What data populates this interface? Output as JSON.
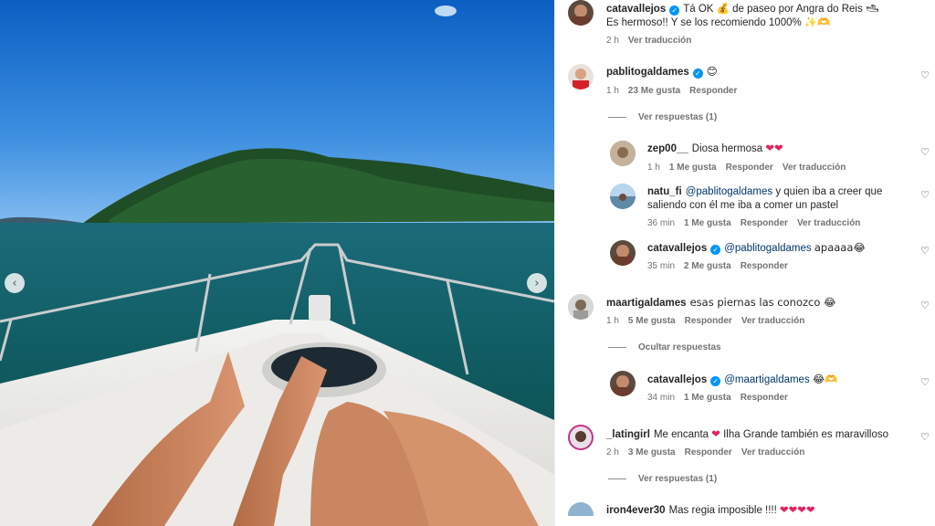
{
  "photo": {
    "prev_icon": "chevron-left-icon",
    "next_icon": "chevron-right-icon",
    "prev_glyph": "‹",
    "next_glyph": "›"
  },
  "caption": {
    "username": "catavallejos",
    "text1": "Tá OK 💰 de paseo por Angra do Reis 🛥",
    "text2": "Es hermoso!! Y se los recomiendo 1000% ✨🫶",
    "time": "2 h",
    "translate": "Ver traducción"
  },
  "comments": [
    {
      "username": "pablitogaldames",
      "verified": true,
      "text": "😊",
      "time": "1 h",
      "likes": "23 Me gusta",
      "reply": "Responder"
    },
    {
      "username": "zep00__",
      "text": "Diosa hermosa",
      "text_suffix": "❤❤",
      "time": "1 h",
      "likes": "1 Me gusta",
      "reply": "Responder",
      "translate": "Ver traducción"
    },
    {
      "username": "natu_fi",
      "mention": "@pablitogaldames",
      "text": "y quien iba a creer que",
      "text2": "saliendo con él me iba a comer un pastel",
      "time": "36 min",
      "likes": "1 Me gusta",
      "reply": "Responder",
      "translate": "Ver traducción"
    },
    {
      "username": "catavallejos",
      "verified": true,
      "mention": "@pablitogaldames",
      "text": "apaaaa😂",
      "time": "35 min",
      "likes": "2 Me gusta",
      "reply": "Responder"
    },
    {
      "username": "maartigaldames",
      "text": "esas piernas las conozco 😂",
      "time": "1 h",
      "likes": "5 Me gusta",
      "reply": "Responder",
      "translate": "Ver traducción"
    },
    {
      "username": "catavallejos",
      "verified": true,
      "mention": "@maartigaldames",
      "text": "😂🫶",
      "time": "34 min",
      "likes": "1 Me gusta",
      "reply": "Responder"
    },
    {
      "username": "_latingirl",
      "text": "Me encanta",
      "text_heart": "❤",
      "text_after": "Ilha Grande también es maravilloso",
      "time": "2 h",
      "likes": "3 Me gusta",
      "reply": "Responder",
      "translate": "Ver traducción"
    },
    {
      "username": "iron4ever30",
      "text": "Mas regia imposible !!!!",
      "text_suffix": "❤❤❤❤",
      "partial": true
    }
  ],
  "replies_toggles": {
    "view_1": "Ver respuestas (1)",
    "hide": "Ocultar respuestas",
    "view_2": "Ver respuestas (1)"
  },
  "icons": {
    "like": "heart-icon",
    "verified": "verified-badge-icon",
    "like_glyph": "♡",
    "verified_glyph": "✓"
  },
  "colors": {
    "link": "#00376b",
    "muted": "#737373",
    "verified": "#0095f6",
    "heart_red": "#e0245e"
  }
}
